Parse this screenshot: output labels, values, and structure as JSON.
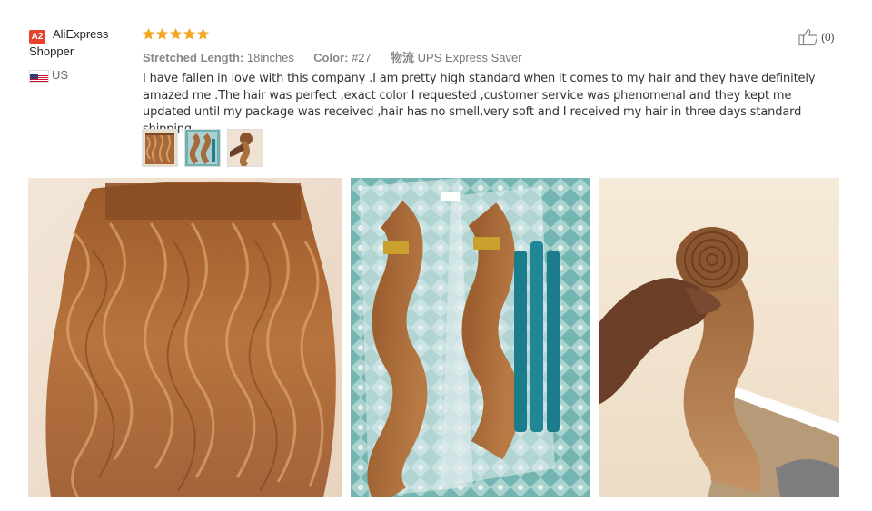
{
  "reviewer": {
    "badge": "A2",
    "name_line1": "AliExpress",
    "name_line2": "Shopper",
    "country": "US"
  },
  "rating": {
    "stars": 5,
    "color": "#f5a623"
  },
  "meta": {
    "length_label": "Stretched Length:",
    "length_value": "18inches",
    "color_label": "Color:",
    "color_value": "#27",
    "shipping_label": "物流",
    "shipping_value": "UPS Express Saver"
  },
  "review_text": "I have fallen in love with this company .I am pretty high standard when it comes to my hair and they have definitely amazed me .The hair was perfect ,exact color I requested ,customer service was phenomenal and they kept me updated until my package was received ,hair has no smell,very soft and I received my hair in three days standard shipping .",
  "helpful": {
    "count": "(0)",
    "icon": "thumbs-up-icon"
  },
  "thumbnails": [
    "hair-weft-thumbnail",
    "hair-bundles-packaged-thumbnail",
    "hair-bundle-in-hand-thumbnail"
  ],
  "photos": [
    "hair-weft-photo",
    "hair-bundles-packaged-photo",
    "hair-bundle-in-hand-photo"
  ]
}
